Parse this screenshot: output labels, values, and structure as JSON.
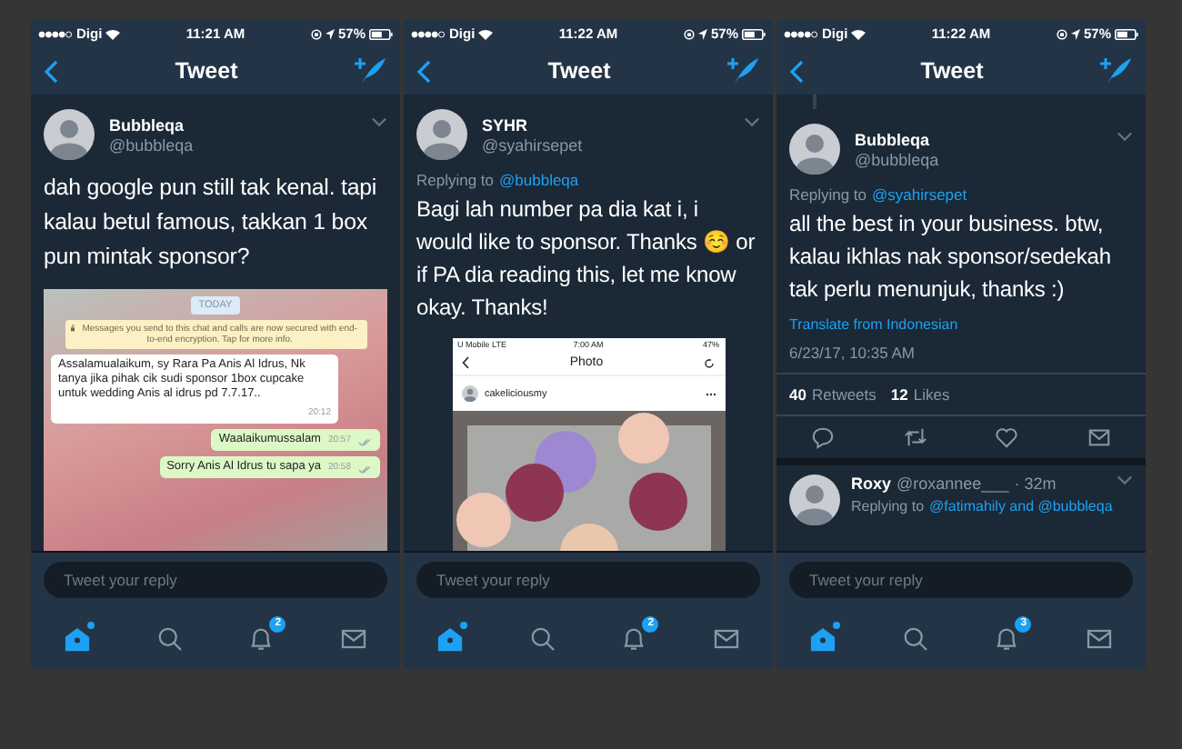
{
  "phones": [
    {
      "status": {
        "carrier": "Digi",
        "time": "11:21 AM",
        "battery": "57%"
      },
      "title": "Tweet",
      "tweet": {
        "name": "Bubbleqa",
        "handle": "@bubbleqa",
        "text": "dah google pun still tak kenal. tapi kalau betul famous, takkan 1 box pun mintak sponsor?",
        "media": {
          "kind": "chat",
          "date": "TODAY",
          "notice": "Messages you send to this chat and calls are now secured with end-to-end encryption. Tap for more info.",
          "messages": [
            {
              "kind": "incoming",
              "text": "Assalamualaikum, sy Rara Pa Anis Al Idrus, Nk tanya jika pihak cik sudi sponsor 1box cupcake untuk wedding Anis al idrus pd 7.7.17..",
              "time": "20:12"
            },
            {
              "kind": "outgoing",
              "text": "Waalaikumussalam",
              "time": "20:57"
            },
            {
              "kind": "outgoing",
              "text": "Sorry Anis Al Idrus tu sapa ya",
              "time": "20:58"
            }
          ]
        }
      },
      "reply_placeholder": "Tweet your reply",
      "tabs": [
        {
          "kind": "home",
          "selected": true,
          "dot": true
        },
        {
          "kind": "search",
          "selected": false
        },
        {
          "kind": "notifications",
          "selected": false,
          "badge": "2"
        },
        {
          "kind": "messages",
          "selected": false
        }
      ]
    },
    {
      "status": {
        "carrier": "Digi",
        "time": "11:22 AM",
        "battery": "57%"
      },
      "title": "Tweet",
      "tweet": {
        "name": "SYHR",
        "handle": "@syahirsepet",
        "replying_prefix": "Replying to",
        "replying_target": "@bubbleqa",
        "text": "Bagi lah number pa dia kat i, i would like to sponsor. Thanks ☺️ or if PA dia reading this, let me know okay. Thanks!",
        "media": {
          "kind": "photo_app",
          "status": {
            "carrier": "U Mobile",
            "network": "LTE",
            "time": "7:00 AM",
            "battery": "47%"
          },
          "title": "Photo",
          "username": "cakeliciousmy"
        }
      },
      "reply_placeholder": "Tweet your reply",
      "tabs": [
        {
          "kind": "home",
          "selected": true,
          "dot": true
        },
        {
          "kind": "search",
          "selected": false
        },
        {
          "kind": "notifications",
          "selected": false,
          "badge": "2"
        },
        {
          "kind": "messages",
          "selected": false
        }
      ]
    },
    {
      "status": {
        "carrier": "Digi",
        "time": "11:22 AM",
        "battery": "57%"
      },
      "title": "Tweet",
      "tweet": {
        "thread_line_above": true,
        "name": "Bubbleqa",
        "handle": "@bubbleqa",
        "replying_prefix": "Replying to",
        "replying_target": "@syahirsepet",
        "text": "all the best in your business. btw, kalau ikhlas nak sponsor/sedekah tak perlu menunjuk, thanks :)",
        "translate": "Translate from Indonesian",
        "timestamp": "6/23/17, 10:35 AM",
        "stats": [
          {
            "count": "40",
            "label": "Retweets"
          },
          {
            "count": "12",
            "label": "Likes"
          }
        ],
        "actions": true
      },
      "replies": [
        {
          "name": "Roxy",
          "handle": "@roxannee___",
          "time": "· 32m",
          "replying_prefix": "Replying to",
          "replying_target": "@fatimahily and @bubbleqa"
        }
      ],
      "reply_placeholder": "Tweet your reply",
      "tabs": [
        {
          "kind": "home",
          "selected": true,
          "dot": true
        },
        {
          "kind": "search",
          "selected": false
        },
        {
          "kind": "notifications",
          "selected": false,
          "badge": "3"
        },
        {
          "kind": "messages",
          "selected": false
        }
      ]
    }
  ]
}
